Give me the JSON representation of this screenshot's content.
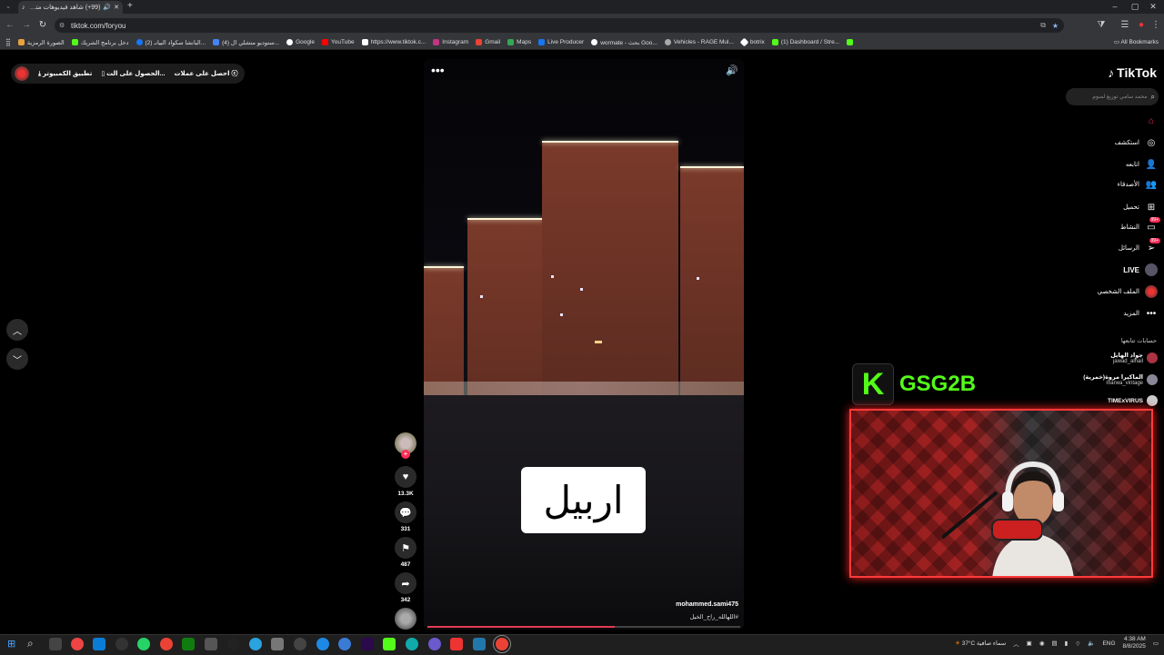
{
  "browser": {
    "tab_title": "(99+) شاهد فيديوهات متصد...",
    "url": "tiktok.com/foryou",
    "bookmarks": [
      {
        "label": "الصورة الرمزية",
        "color": "#e8a33d"
      },
      {
        "label": "دخل برنامج الشريك",
        "color": "#53fc18"
      },
      {
        "label": "(2) البانشا سكواد البيانـ...",
        "color": "#1877f2"
      },
      {
        "label": "(4) ستوديو منشلي ال...",
        "color": "#4285f4"
      },
      {
        "label": "Google",
        "color": "#ffffff"
      },
      {
        "label": "YouTube",
        "color": "#ff0000"
      },
      {
        "label": "https://www.tiktok.c...",
        "color": "#ffffff"
      },
      {
        "label": "Instagram",
        "color": "#c13584"
      },
      {
        "label": "Gmail",
        "color": "#ea4335"
      },
      {
        "label": "Maps",
        "color": "#34a853"
      },
      {
        "label": "Live Producer",
        "color": "#1877f2"
      },
      {
        "label": "wormate - بحث Goo...",
        "color": "#ffffff"
      },
      {
        "label": "Vehicles - RAGE Mul...",
        "color": "#aaaaaa"
      },
      {
        "label": "botrix",
        "color": "#ffffff"
      },
      {
        "label": "(1) Dashboard / Stre...",
        "color": "#53fc18"
      },
      {
        "label": "",
        "color": "#53fc18"
      }
    ],
    "all_bookmarks": "All Bookmarks"
  },
  "top_left": {
    "coins": "احصل على عملات",
    "get_app": "الحصول على الت...",
    "pc_app": "تطبيق الكمبيوتر"
  },
  "video": {
    "caption": "اربيل",
    "author": "mohammed.sami475",
    "description": "اللهالله_راح_الخيل#",
    "progress": 0.6
  },
  "actions": {
    "likes": "13.3K",
    "comments": "331",
    "saves": "487",
    "shares": "342"
  },
  "sidebar": {
    "logo": "TikTok",
    "search_placeholder": "محمد سامي توزيع لمنوم",
    "nav": [
      {
        "label": "",
        "icon": "home-icon"
      },
      {
        "label": "استكشف",
        "icon": "compass-icon"
      },
      {
        "label": "اتابعه",
        "icon": "following-icon"
      },
      {
        "label": "الأصدقاء",
        "icon": "friends-icon"
      },
      {
        "label": "تحميل",
        "icon": "upload-icon"
      },
      {
        "label": "النشاط",
        "icon": "activity-icon",
        "badge": "99+"
      },
      {
        "label": "الرسائل",
        "icon": "messages-icon",
        "badge": "99+"
      },
      {
        "label": "LIVE",
        "icon": "live-icon"
      },
      {
        "label": "الملف الشخصي",
        "icon": "profile-icon"
      },
      {
        "label": "المزيد",
        "icon": "more-icon"
      }
    ],
    "following_header": "حسابات تتابعها",
    "following": [
      {
        "name": "جواد الهايل",
        "handle": "jawad_alhail"
      },
      {
        "name": "الماكيرا مروة(خمرية)",
        "handle": "marwa_vintage"
      },
      {
        "name": "TIMExVIRUS",
        "handle": ""
      }
    ]
  },
  "overlay": {
    "channel": "GSG2B"
  },
  "taskbar": {
    "weather": "37°C",
    "weather_text": "سماء صافية",
    "lang": "ENG",
    "time": "4:38 AM",
    "date": "8/8/2025"
  },
  "colors": {
    "accent": "#fe2c55",
    "kick_green": "#53fc18"
  }
}
